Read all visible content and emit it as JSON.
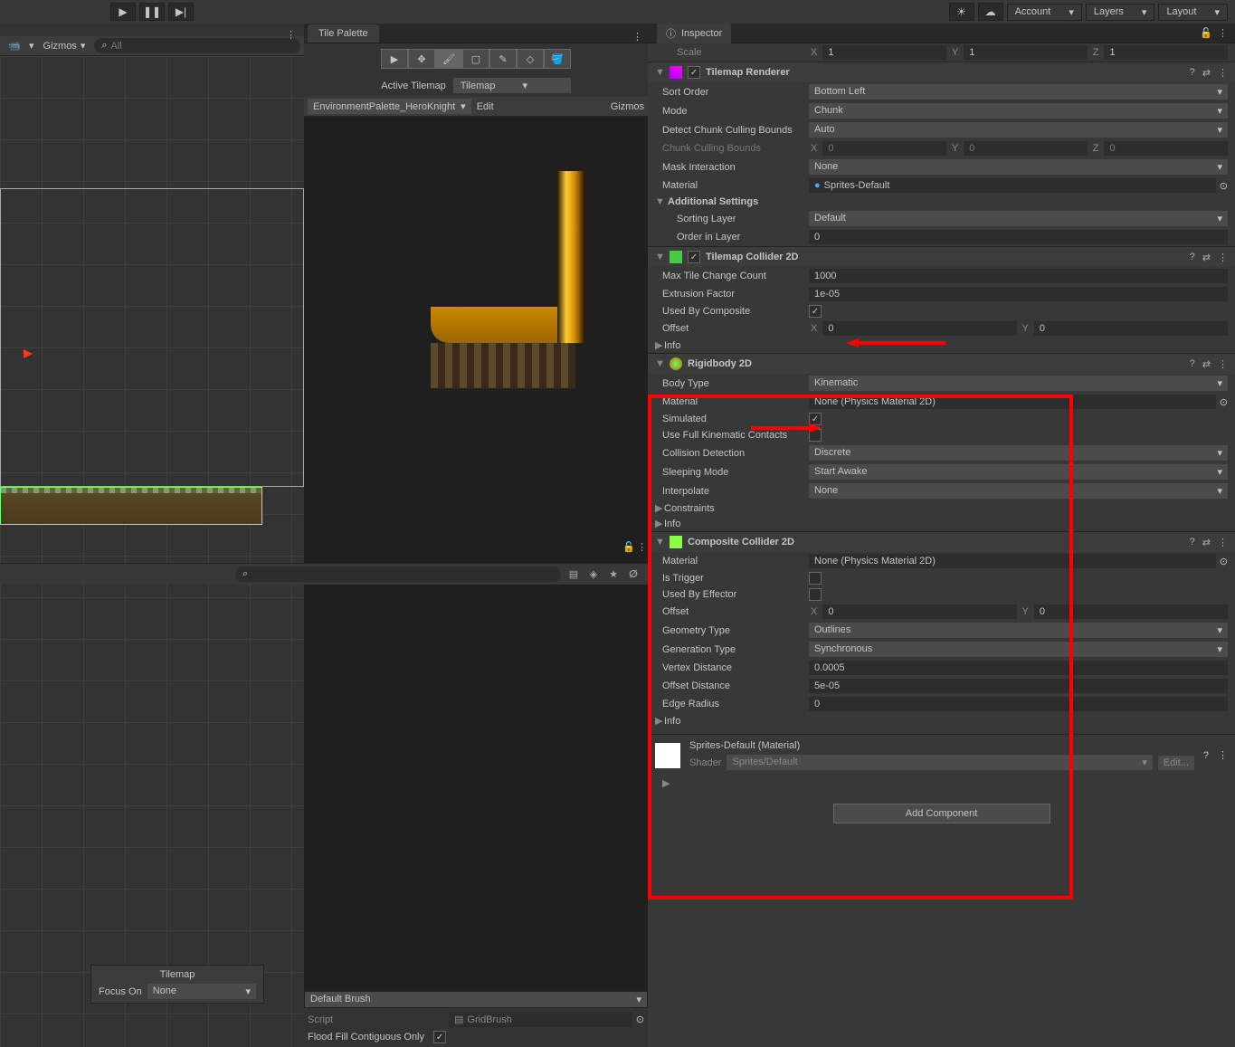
{
  "topbar": {
    "account": "Account",
    "layers": "Layers",
    "layout": "Layout"
  },
  "scene": {
    "gizmos": "Gizmos",
    "search_placeholder": "All",
    "focus_title": "Tilemap",
    "focus_on": "Focus On",
    "focus_value": "None"
  },
  "palette": {
    "tab": "Tile Palette",
    "active_tilemap_label": "Active Tilemap",
    "active_tilemap_value": "Tilemap",
    "palette_name": "EnvironmentPalette_HeroKnight",
    "edit": "Edit",
    "gizmos": "Gizmos",
    "brush": "Default Brush",
    "script_label": "Script",
    "script_value": "GridBrush",
    "flood_label": "Flood Fill Contiguous Only"
  },
  "inspector": {
    "tab": "Inspector",
    "scale": "Scale",
    "scale_x": "1",
    "scale_y": "1",
    "scale_z": "1",
    "renderer": {
      "title": "Tilemap Renderer",
      "sort_order_label": "Sort Order",
      "sort_order": "Bottom Left",
      "mode_label": "Mode",
      "mode": "Chunk",
      "detect_label": "Detect Chunk Culling Bounds",
      "detect": "Auto",
      "culling_label": "Chunk Culling Bounds",
      "cx": "0",
      "cy": "0",
      "cz": "0",
      "mask_label": "Mask Interaction",
      "mask": "None",
      "material_label": "Material",
      "material": "Sprites-Default",
      "additional": "Additional Settings",
      "sorting_layer_label": "Sorting Layer",
      "sorting_layer": "Default",
      "order_label": "Order in Layer",
      "order": "0"
    },
    "collider": {
      "title": "Tilemap Collider 2D",
      "max_tile_label": "Max Tile Change Count",
      "max_tile": "1000",
      "extrusion_label": "Extrusion Factor",
      "extrusion": "1e-05",
      "used_label": "Used By Composite",
      "offset_label": "Offset",
      "ox": "0",
      "oy": "0",
      "info": "Info"
    },
    "rigidbody": {
      "title": "Rigidbody 2D",
      "body_type_label": "Body Type",
      "body_type": "Kinematic",
      "material_label": "Material",
      "material": "None (Physics Material 2D)",
      "simulated_label": "Simulated",
      "full_kin_label": "Use Full Kinematic Contacts",
      "collision_label": "Collision Detection",
      "collision": "Discrete",
      "sleep_label": "Sleeping Mode",
      "sleep": "Start Awake",
      "interpolate_label": "Interpolate",
      "interpolate": "None",
      "constraints": "Constraints",
      "info": "Info"
    },
    "composite": {
      "title": "Composite Collider 2D",
      "material_label": "Material",
      "material": "None (Physics Material 2D)",
      "trigger_label": "Is Trigger",
      "effector_label": "Used By Effector",
      "offset_label": "Offset",
      "ox": "0",
      "oy": "0",
      "geom_label": "Geometry Type",
      "geom": "Outlines",
      "gen_label": "Generation Type",
      "gen": "Synchronous",
      "vertex_label": "Vertex Distance",
      "vertex": "0.0005",
      "offset_d_label": "Offset Distance",
      "offset_d": "5e-05",
      "edge_label": "Edge Radius",
      "edge": "0",
      "info": "Info"
    },
    "material": {
      "title": "Sprites-Default (Material)",
      "shader_label": "Shader",
      "shader": "Sprites/Default",
      "edit": "Edit..."
    },
    "add_component": "Add Component"
  }
}
